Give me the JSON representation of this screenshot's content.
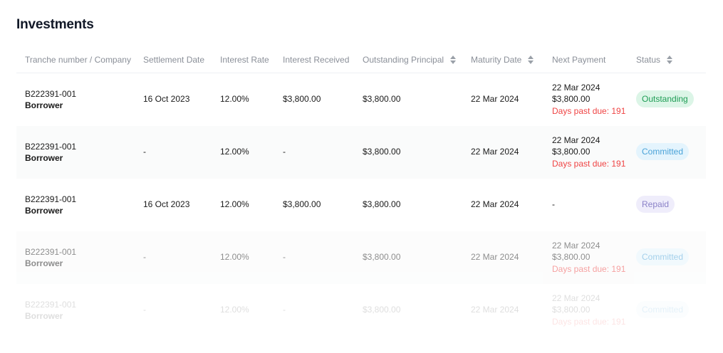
{
  "page": {
    "title": "Investments"
  },
  "columns": {
    "tranche": "Tranche number / Company",
    "settlement": "Settlement Date",
    "interest_rate": "Interest Rate",
    "interest_received": "Interest Received",
    "outstanding_principal": "Outstanding Principal",
    "maturity": "Maturity Date",
    "next_payment": "Next Payment",
    "status": "Status"
  },
  "rows": [
    {
      "tranche": "B222391-001",
      "company": "Borrower",
      "settlement": "16 Oct 2023",
      "interest_rate": "12.00%",
      "interest_received": "$3,800.00",
      "outstanding_principal": "$3,800.00",
      "maturity": "22 Mar 2024",
      "next_payment_date": "22 Mar 2024",
      "next_payment_amount": "$3,800.00",
      "days_past_due": "Days past due: 191",
      "status": "Outstanding"
    },
    {
      "tranche": "B222391-001",
      "company": "Borrower",
      "settlement": "-",
      "interest_rate": "12.00%",
      "interest_received": "-",
      "outstanding_principal": "$3,800.00",
      "maturity": "22 Mar 2024",
      "next_payment_date": "22 Mar 2024",
      "next_payment_amount": "$3,800.00",
      "days_past_due": "Days past due: 191",
      "status": "Committed"
    },
    {
      "tranche": "B222391-001",
      "company": "Borrower",
      "settlement": "16 Oct 2023",
      "interest_rate": "12.00%",
      "interest_received": "$3,800.00",
      "outstanding_principal": "$3,800.00",
      "maturity": "22 Mar 2024",
      "next_payment": "-",
      "status": "Repaid"
    },
    {
      "tranche": "B222391-001",
      "company": "Borrower",
      "settlement": "-",
      "interest_rate": "12.00%",
      "interest_received": "-",
      "outstanding_principal": "$3,800.00",
      "maturity": "22 Mar 2024",
      "next_payment_date": "22 Mar 2024",
      "next_payment_amount": "$3,800.00",
      "days_past_due": "Days past due: 191",
      "status": "Committed"
    },
    {
      "tranche": "B222391-001",
      "company": "Borrower",
      "settlement": "-",
      "interest_rate": "12.00%",
      "interest_received": "-",
      "outstanding_principal": "$3,800.00",
      "maturity": "22 Mar 2024",
      "next_payment_date": "22 Mar 2024",
      "next_payment_amount": "$3,800.00",
      "days_past_due": "Days past due: 191",
      "status": "Committed"
    }
  ],
  "icons": {
    "sort": "sort-icon"
  },
  "colors": {
    "outstanding_bg": "#dcf5e7",
    "outstanding_text": "#1f9d55",
    "committed_bg": "#e4f4fd",
    "committed_text": "#4ba3d8",
    "repaid_bg": "#efedfb",
    "repaid_text": "#8b82c8",
    "past_due": "#ef4444"
  }
}
